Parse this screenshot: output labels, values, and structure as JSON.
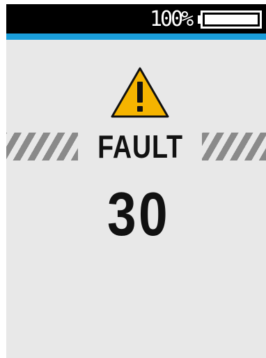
{
  "status_bar": {
    "battery_text": "100%",
    "battery_level": 1.0
  },
  "alert": {
    "icon": "warning-triangle-icon",
    "label": "FAULT",
    "code": "30"
  },
  "colors": {
    "status_bar": "#000000",
    "accent_line": "#1a9edb",
    "screen_bg": "#e8e8e8",
    "warning_fill": "#f5b400",
    "hazard_stripes": "#8a8a8a",
    "text": "#111111"
  }
}
